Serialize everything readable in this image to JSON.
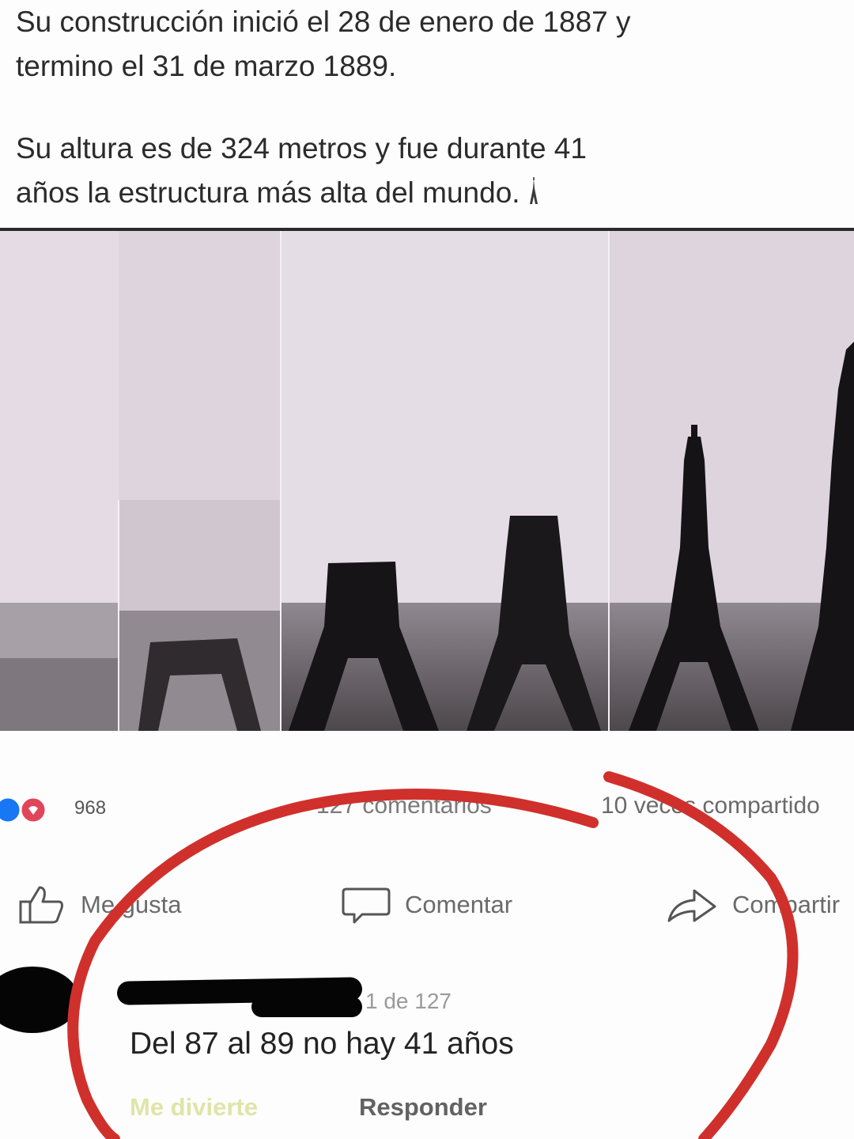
{
  "post": {
    "line1": "Su construcción inició el 28 de enero de 1887 y",
    "line2": "termino el 31 de marzo 1889.",
    "line3": "Su altura es de 324 metros y fue durante 41",
    "line4": "años la estructura más alta del mundo.",
    "emoji": "tower-icon"
  },
  "photo": {
    "panels": 5,
    "subject": "eiffel-tower-construction-sequence"
  },
  "stats": {
    "reaction_count": "968",
    "comments": "127 comentarios",
    "shares": "10 veces compartido"
  },
  "actions": {
    "like": "Me gusta",
    "comment": "Comentar",
    "share": "Compartir"
  },
  "comment": {
    "meta": "1 de 127",
    "text": "Del 87 al 89 no hay 41 años",
    "laugh": "Me divierte",
    "reply": "Responder"
  },
  "colors": {
    "highlight_circle": "#d0302c",
    "like_blue": "#1877f2",
    "love_red": "#e0455a"
  }
}
